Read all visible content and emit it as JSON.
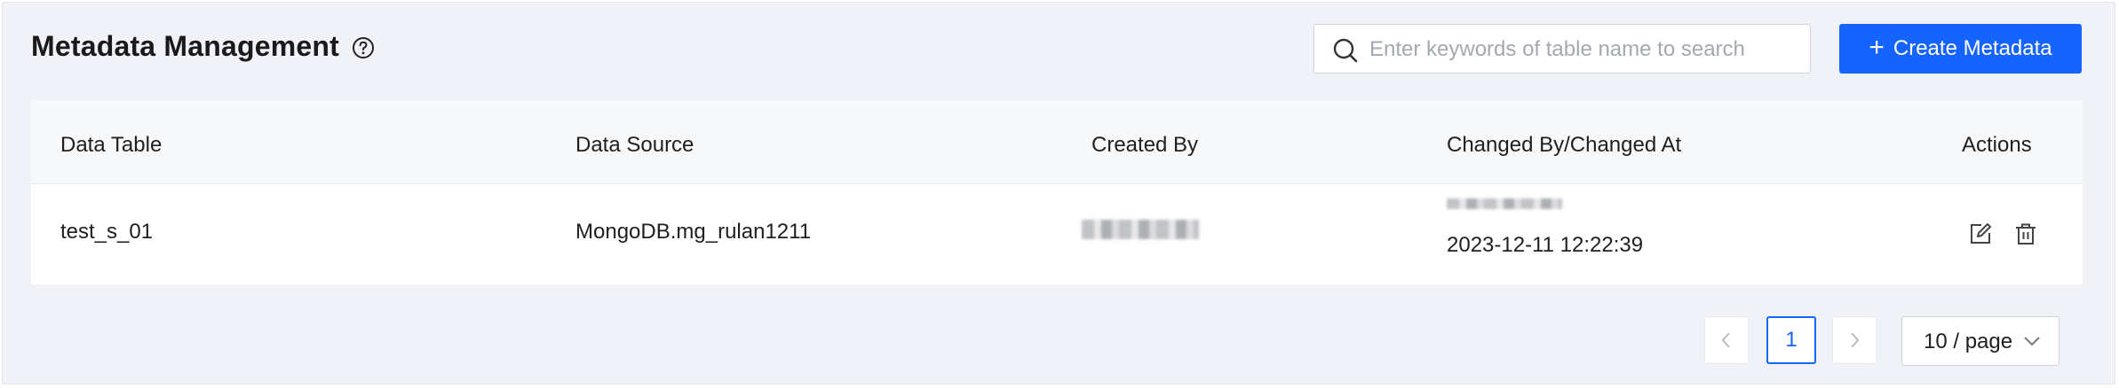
{
  "header": {
    "title": "Metadata Management",
    "search_placeholder": "Enter keywords of table name to search",
    "create_label": "Create Metadata"
  },
  "table": {
    "columns": [
      "Data Table",
      "Data Source",
      "Created By",
      "Changed By/Changed At",
      "Actions"
    ],
    "rows": [
      {
        "data_table": "test_s_01",
        "data_source": "MongoDB.mg_rulan1211",
        "changed_at": "2023-12-11 12:22:39"
      }
    ]
  },
  "pagination": {
    "current_page": "1",
    "page_size": "10 / page"
  },
  "colors": {
    "primary": "#1664ff",
    "background": "#f0f2f7"
  },
  "icons": [
    "help-circle-icon",
    "search-icon",
    "plus-icon",
    "edit-icon",
    "delete-icon",
    "chevron-left-icon",
    "chevron-right-icon",
    "chevron-down-icon"
  ]
}
